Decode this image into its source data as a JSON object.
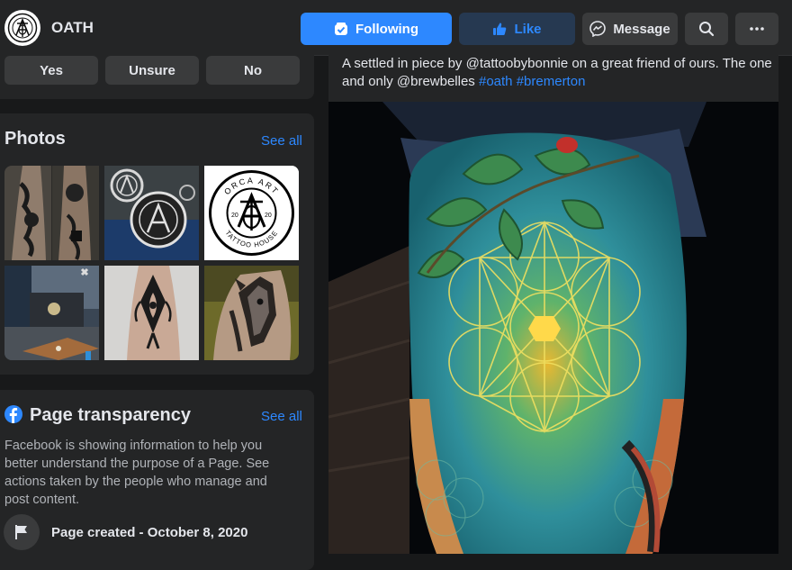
{
  "header": {
    "page_name": "OATH",
    "buttons": {
      "following": "Following",
      "like": "Like",
      "message": "Message"
    }
  },
  "rsvp": {
    "yes": "Yes",
    "unsure": "Unsure",
    "no": "No"
  },
  "photos": {
    "title": "Photos",
    "see_all": "See all",
    "logo_ring_text": "ORCA ART",
    "logo_bottom_text": "TATTOO HOUSE",
    "logo_year_left": "20",
    "logo_year_right": "20",
    "items": [
      {
        "name": "forearm-tattoo-photo"
      },
      {
        "name": "logo-stamp-photo"
      },
      {
        "name": "orca-art-logo-photo"
      },
      {
        "name": "shop-interior-photo"
      },
      {
        "name": "ornamental-tattoo-photo"
      },
      {
        "name": "horse-tattoo-photo"
      }
    ]
  },
  "transparency": {
    "title": "Page transparency",
    "see_all": "See all",
    "description": "Facebook is showing information to help you better understand the purpose of a Page. See actions taken by the people who manage and post content.",
    "page_created": "Page created - October 8, 2020"
  },
  "post": {
    "text_main": "A settled in piece by @tattoobybonnie on a great friend of ours. The one and only @brewbelles ",
    "hashtag1": "#oath",
    "hashtag2": "#bremerton",
    "image_alt": "Sacred geometry thigh tattoo with leaves"
  },
  "colors": {
    "background": "#18191a",
    "surface": "#242526",
    "button_gray": "#3a3b3c",
    "accent_blue": "#2d88ff",
    "like_bg": "#263951",
    "text_primary": "#e4e6eb",
    "text_secondary": "#b0b3b8"
  },
  "icons": {
    "following": "checkmark-box-icon",
    "like": "thumbs-up-icon",
    "message": "messenger-icon",
    "search": "search-icon",
    "more": "more-dots-icon",
    "transparency": "facebook-icon",
    "page_created": "flag-icon"
  }
}
